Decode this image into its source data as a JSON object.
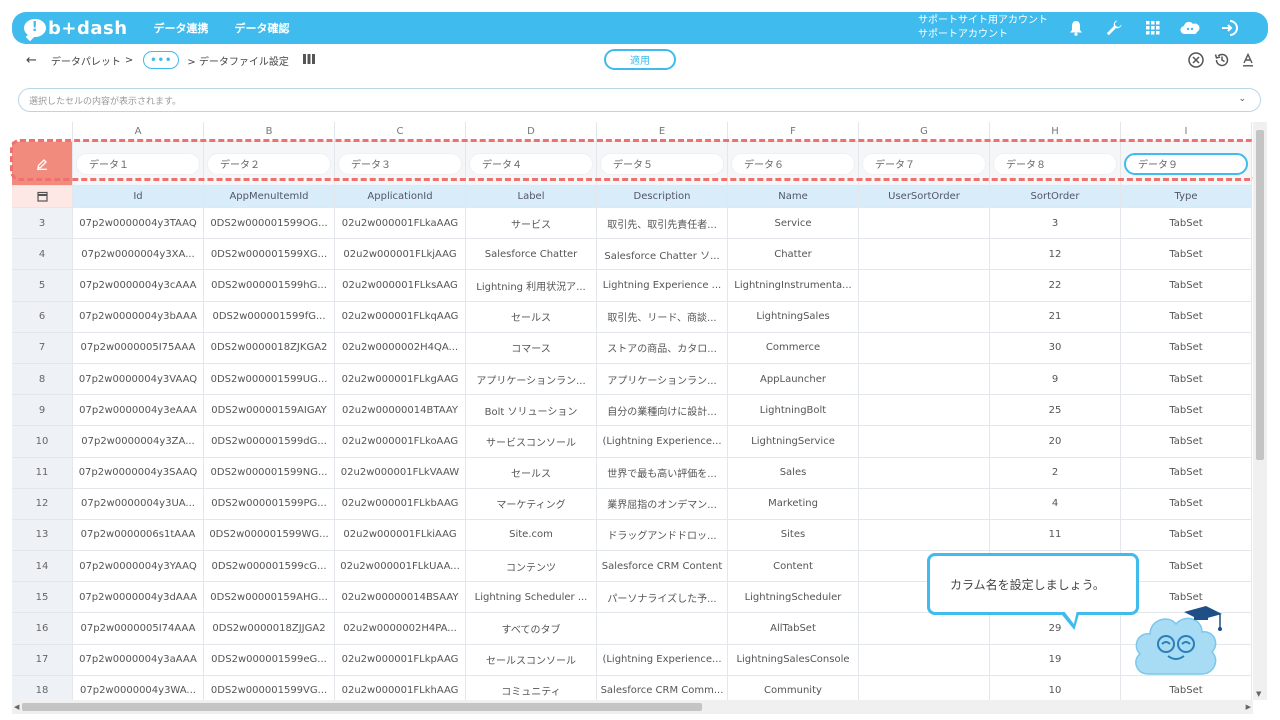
{
  "header": {
    "logo_text": "b+dash",
    "logo_bubble": "!",
    "nav": [
      "データ連携",
      "データ確認"
    ],
    "account_line1": "サポートサイト用アカウント",
    "account_line2": "サポートアカウント",
    "icons": [
      "bell-icon",
      "wrench-icon",
      "grid-menu-icon",
      "cloud-mascot-icon",
      "logout-icon"
    ]
  },
  "toolbar": {
    "back": "←",
    "crumb1": "データパレット",
    "sep": ">",
    "dots": "•••",
    "crumb2": "> データファイル設定",
    "apply_label": "適用",
    "right_icons": [
      "close-circle-icon",
      "history-icon",
      "text-format-icon"
    ]
  },
  "cellbar": {
    "placeholder": "選択したセルの内容が表示されます。"
  },
  "grid": {
    "column_letters": [
      "A",
      "B",
      "C",
      "D",
      "E",
      "F",
      "G",
      "H",
      "I"
    ],
    "column_inputs": [
      "データ１",
      "データ２",
      "データ３",
      "データ４",
      "データ５",
      "データ６",
      "データ７",
      "データ８",
      "データ９"
    ],
    "headers": [
      "Id",
      "AppMenuItemId",
      "ApplicationId",
      "Label",
      "Description",
      "Name",
      "UserSortOrder",
      "SortOrder",
      "Type"
    ],
    "rows": [
      {
        "num": "3",
        "cells": [
          "07p2w0000004y3TAAQ",
          "0DS2w000001599OG...",
          "02u2w000001FLkaAAG",
          "サービス",
          "取引先、取引先責任者...",
          "Service",
          "",
          "3",
          "TabSet"
        ]
      },
      {
        "num": "4",
        "cells": [
          "07p2w0000004y3XA...",
          "0DS2w000001599XG...",
          "02u2w000001FLkjAAG",
          "Salesforce Chatter",
          "Salesforce Chatter ソ...",
          "Chatter",
          "",
          "12",
          "TabSet"
        ]
      },
      {
        "num": "5",
        "cells": [
          "07p2w0000004y3cAAA",
          "0DS2w000001599hG...",
          "02u2w000001FLksAAG",
          "Lightning 利用状況ア...",
          "Lightning Experience ...",
          "LightningInstrumenta...",
          "",
          "22",
          "TabSet"
        ]
      },
      {
        "num": "6",
        "cells": [
          "07p2w0000004y3bAAA",
          "0DS2w000001599fG...",
          "02u2w000001FLkqAAG",
          "セールス",
          "取引先、リード、商談...",
          "LightningSales",
          "",
          "21",
          "TabSet"
        ]
      },
      {
        "num": "7",
        "cells": [
          "07p2w0000005I75AAA",
          "0DS2w0000018ZJKGA2",
          "02u2w0000002H4QA...",
          "コマース",
          "ストアの商品、カタロ...",
          "Commerce",
          "",
          "30",
          "TabSet"
        ]
      },
      {
        "num": "8",
        "cells": [
          "07p2w0000004y3VAAQ",
          "0DS2w000001599UG...",
          "02u2w000001FLkgAAG",
          "アプリケーションラン...",
          "アプリケーションラン...",
          "AppLauncher",
          "",
          "9",
          "TabSet"
        ]
      },
      {
        "num": "9",
        "cells": [
          "07p2w0000004y3eAAA",
          "0DS2w00000159AIGAY",
          "02u2w00000014BTAAY",
          "Bolt ソリューション",
          "自分の業種向けに設計...",
          "LightningBolt",
          "",
          "25",
          "TabSet"
        ]
      },
      {
        "num": "10",
        "cells": [
          "07p2w0000004y3ZA...",
          "0DS2w000001599dG...",
          "02u2w000001FLkoAAG",
          "サービスコンソール",
          "(Lightning Experience...",
          "LightningService",
          "",
          "20",
          "TabSet"
        ]
      },
      {
        "num": "11",
        "cells": [
          "07p2w0000004y3SAAQ",
          "0DS2w000001599NG...",
          "02u2w000001FLkVAAW",
          "セールス",
          "世界で最も高い評価を...",
          "Sales",
          "",
          "2",
          "TabSet"
        ]
      },
      {
        "num": "12",
        "cells": [
          "07p2w0000004y3UA...",
          "0DS2w000001599PG...",
          "02u2w000001FLkbAAG",
          "マーケティング",
          "業界屈指のオンデマン...",
          "Marketing",
          "",
          "4",
          "TabSet"
        ]
      },
      {
        "num": "13",
        "cells": [
          "07p2w0000006s1tAAA",
          "0DS2w000001599WG...",
          "02u2w000001FLkiAAG",
          "Site.com",
          "ドラッグアンドドロッ...",
          "Sites",
          "",
          "11",
          "TabSet"
        ]
      },
      {
        "num": "14",
        "cells": [
          "07p2w0000004y3YAAQ",
          "0DS2w000001599cG...",
          "02u2w000001FLkUAA...",
          "コンテンツ",
          "Salesforce CRM Content",
          "Content",
          "",
          "",
          "TabSet"
        ]
      },
      {
        "num": "15",
        "cells": [
          "07p2w0000004y3dAAA",
          "0DS2w00000159AHG...",
          "02u2w00000014BSAAY",
          "Lightning Scheduler ...",
          "パーソナライズした予...",
          "LightningScheduler",
          "",
          "",
          "TabSet"
        ]
      },
      {
        "num": "16",
        "cells": [
          "07p2w0000005I74AAA",
          "0DS2w0000018ZJJGA2",
          "02u2w0000002H4PA...",
          "すべてのタブ",
          "",
          "AllTabSet",
          "",
          "29",
          ""
        ]
      },
      {
        "num": "17",
        "cells": [
          "07p2w0000004y3aAAA",
          "0DS2w000001599eG...",
          "02u2w000001FLkpAAG",
          "セールスコンソール",
          "(Lightning Experience...",
          "LightningSalesConsole",
          "",
          "19",
          ""
        ]
      },
      {
        "num": "18",
        "cells": [
          "07p2w0000004y3WA...",
          "0DS2w000001599VG...",
          "02u2w000001FLkhAAG",
          "コミュニティ",
          "Salesforce CRM Comm...",
          "Community",
          "",
          "10",
          "TabSet"
        ]
      }
    ]
  },
  "tooltip": {
    "text": "カラム名を設定しましょう。"
  },
  "colors": {
    "accent": "#3fbbee",
    "header_row": "#d8edf9",
    "corner": "#f18b7e",
    "dashed_highlight": "#f07070"
  }
}
